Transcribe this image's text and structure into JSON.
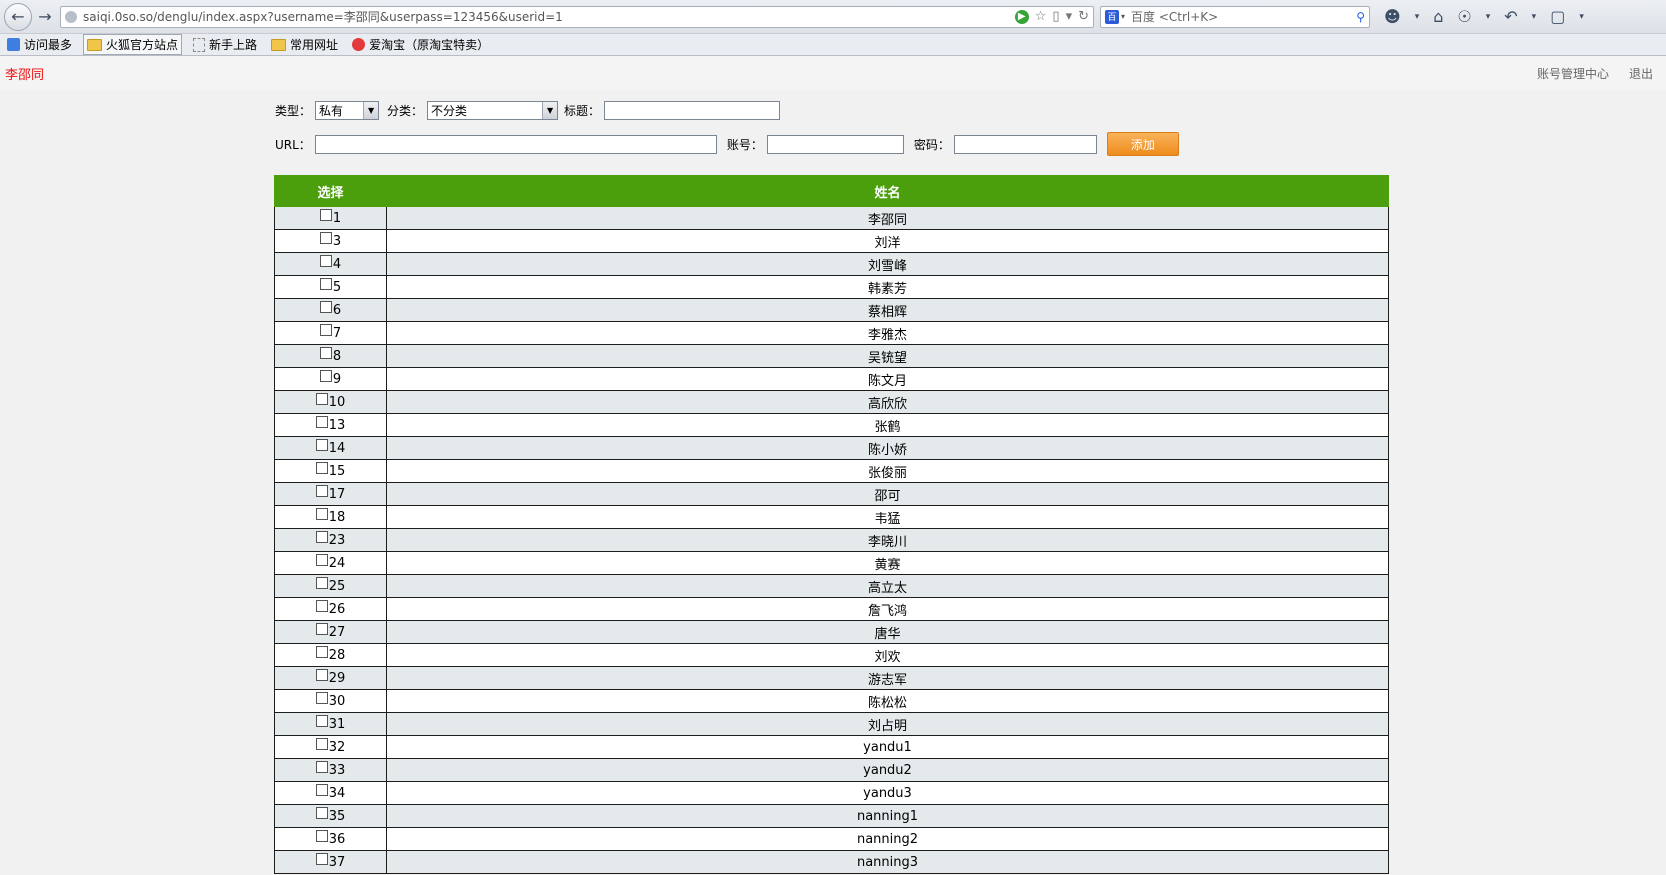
{
  "browser": {
    "url": "saiqi.0so.so/denglu/index.aspx?username=李邵同&userpass=123456&userid=1",
    "search_placeholder": "百度 <Ctrl+K>"
  },
  "bookmarks": [
    {
      "label": "访问最多",
      "icon": "most-visited-icon"
    },
    {
      "label": "火狐官方站点",
      "icon": "folder-icon"
    },
    {
      "label": "新手上路",
      "icon": "page-icon"
    },
    {
      "label": "常用网址",
      "icon": "folder-icon"
    },
    {
      "label": "爱淘宝（原淘宝特卖）",
      "icon": "taobao-icon"
    }
  ],
  "header": {
    "username": "李邵同",
    "account_center": "账号管理中心",
    "logout": "退出"
  },
  "form": {
    "type_label": "类型：",
    "type_value": "私有",
    "category_label": "分类：",
    "category_value": "不分类",
    "title_label": "标题：",
    "title_value": "",
    "url_label": "URL：",
    "url_value": "",
    "account_label": "账号：",
    "account_value": "",
    "password_label": "密码：",
    "password_value": "",
    "add_label": "添加"
  },
  "table": {
    "headers": [
      "选择",
      "姓名"
    ],
    "rows": [
      {
        "id": "1",
        "name": "李邵同"
      },
      {
        "id": "3",
        "name": "刘洋"
      },
      {
        "id": "4",
        "name": "刘雪峰"
      },
      {
        "id": "5",
        "name": "韩素芳"
      },
      {
        "id": "6",
        "name": "蔡相辉"
      },
      {
        "id": "7",
        "name": "李雅杰"
      },
      {
        "id": "8",
        "name": "吴铳望"
      },
      {
        "id": "9",
        "name": "陈文月"
      },
      {
        "id": "10",
        "name": "高欣欣"
      },
      {
        "id": "13",
        "name": "张鹤"
      },
      {
        "id": "14",
        "name": "陈小娇"
      },
      {
        "id": "15",
        "name": "张俊丽"
      },
      {
        "id": "17",
        "name": "邵可"
      },
      {
        "id": "18",
        "name": "韦猛"
      },
      {
        "id": "23",
        "name": "李晓川"
      },
      {
        "id": "24",
        "name": "黄赛"
      },
      {
        "id": "25",
        "name": "高立太"
      },
      {
        "id": "26",
        "name": "詹飞鸿"
      },
      {
        "id": "27",
        "name": "唐华"
      },
      {
        "id": "28",
        "name": "刘欢"
      },
      {
        "id": "29",
        "name": "游志军"
      },
      {
        "id": "30",
        "name": "陈松松"
      },
      {
        "id": "31",
        "name": "刘占明"
      },
      {
        "id": "32",
        "name": "yandu1"
      },
      {
        "id": "33",
        "name": "yandu2"
      },
      {
        "id": "34",
        "name": "yandu3"
      },
      {
        "id": "35",
        "name": "nanning1"
      },
      {
        "id": "36",
        "name": "nanning2"
      },
      {
        "id": "37",
        "name": "nanning3"
      }
    ]
  }
}
